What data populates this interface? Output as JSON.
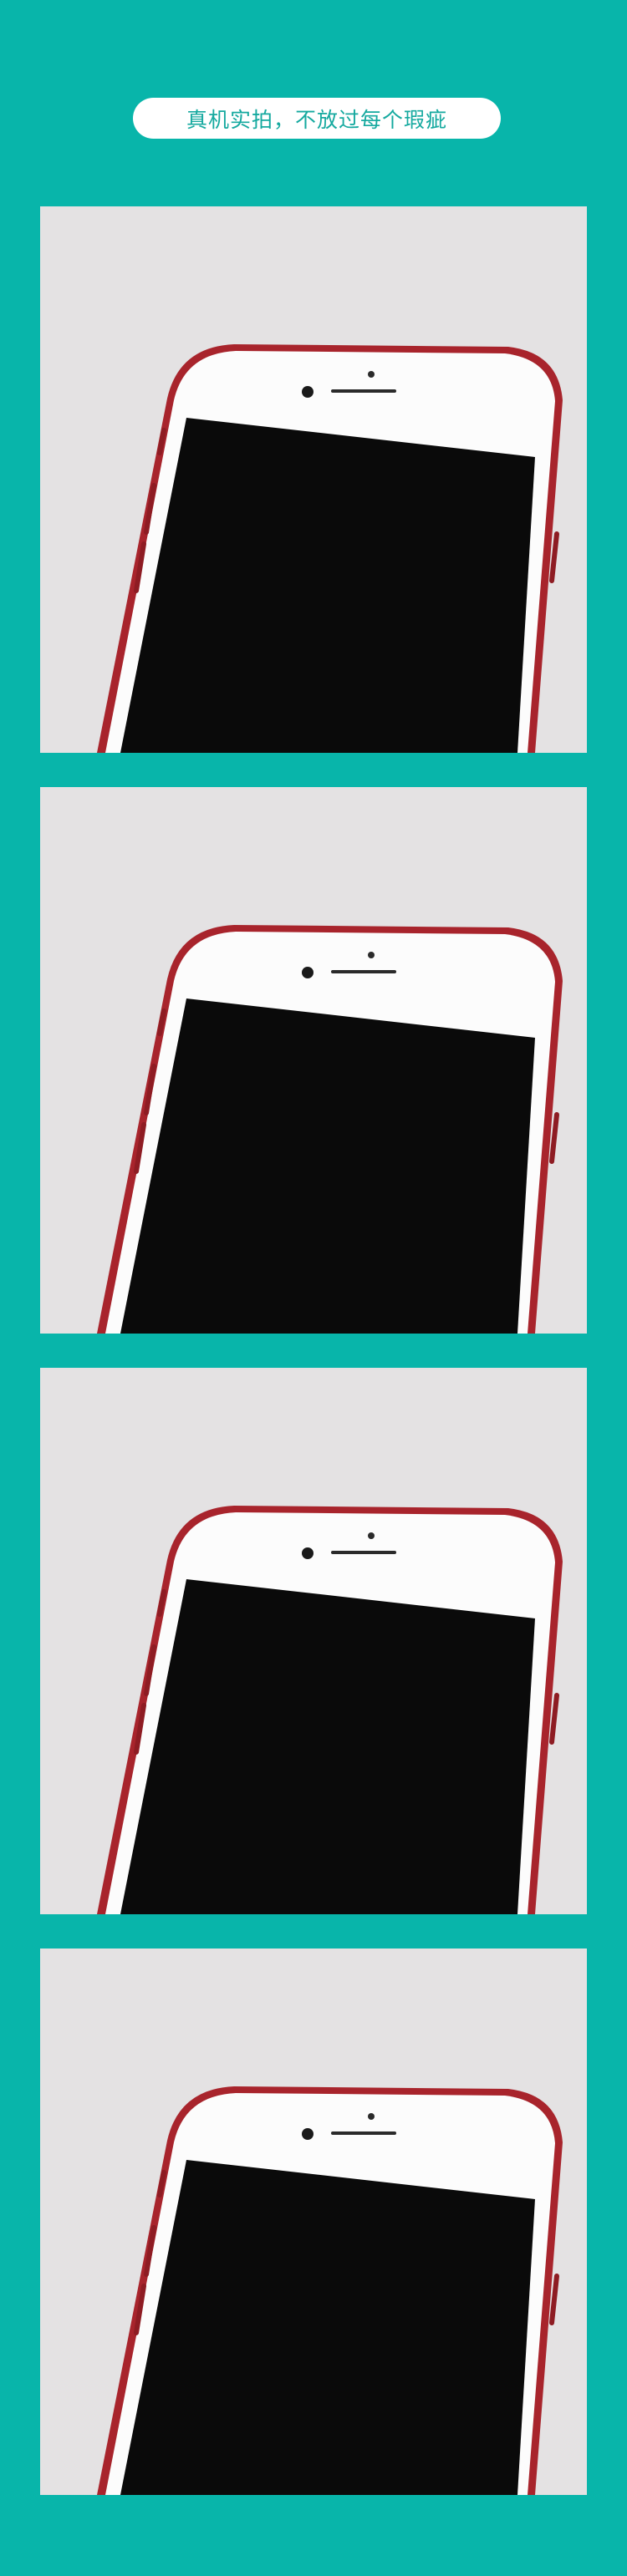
{
  "page": {
    "background_color": "#08b5aa",
    "title": "真机实拍，不放过每个瑕疵"
  },
  "photos": [
    {
      "icon": "iphone-front-top-photo"
    },
    {
      "icon": "iphone-front-top-photo"
    },
    {
      "icon": "iphone-front-top-photo"
    },
    {
      "icon": "iphone-front-top-photo"
    }
  ],
  "colors": {
    "pill_text": "#15a99f",
    "photo_background": "#e4e2e3",
    "phone_body": "#fcfcfc",
    "phone_frame": "#b32a32",
    "screen": "#0a0a0a"
  }
}
